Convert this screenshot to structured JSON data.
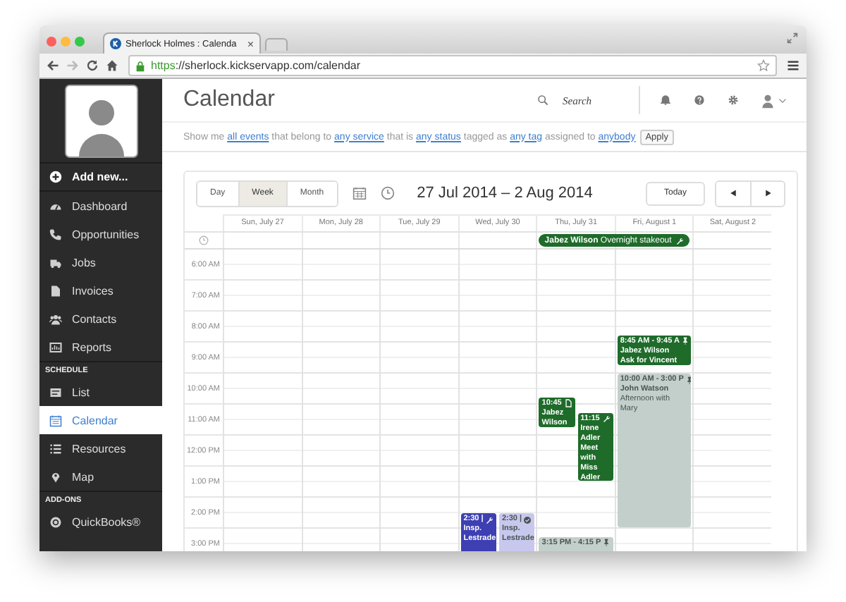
{
  "browser": {
    "tab_title": "Sherlock Holmes : Calenda",
    "tab_close": "×",
    "url_scheme": "https",
    "url_rest": "://sherlock.kickservapp.com/calendar"
  },
  "sidebar": {
    "add_new": "Add new...",
    "groups": [
      {
        "items": [
          {
            "label": "Dashboard",
            "selected": false
          },
          {
            "label": "Opportunities",
            "selected": false
          },
          {
            "label": "Jobs",
            "selected": false
          },
          {
            "label": "Invoices",
            "selected": false
          },
          {
            "label": "Contacts",
            "selected": false
          },
          {
            "label": "Reports",
            "selected": false
          }
        ]
      },
      {
        "heading": "SCHEDULE",
        "items": [
          {
            "label": "List",
            "selected": false
          },
          {
            "label": "Calendar",
            "selected": true
          },
          {
            "label": "Resources",
            "selected": false
          },
          {
            "label": "Map",
            "selected": false
          }
        ]
      },
      {
        "heading": "ADD-ONS",
        "items": [
          {
            "label": "QuickBooks®",
            "selected": false
          }
        ]
      }
    ]
  },
  "header": {
    "title": "Calendar",
    "search": {
      "placeholder": "Search"
    }
  },
  "filter": {
    "parts": [
      {
        "text": "Show me ",
        "link": false
      },
      {
        "text": "all events",
        "link": true
      },
      {
        "text": " that belong to ",
        "link": false
      },
      {
        "text": "any service",
        "link": true
      },
      {
        "text": " that is ",
        "link": false
      },
      {
        "text": "any status",
        "link": true
      },
      {
        "text": " tagged as ",
        "link": false
      },
      {
        "text": "any tag",
        "link": true
      },
      {
        "text": " assigned to ",
        "link": false
      },
      {
        "text": "anybody",
        "link": true
      }
    ],
    "button": "Apply"
  },
  "calendar": {
    "views": [
      {
        "label": "Day",
        "selected": false
      },
      {
        "label": "Week",
        "selected": true
      },
      {
        "label": "Month",
        "selected": false
      }
    ],
    "range": "27 Jul 2014 – 2 Aug 2014",
    "today_button": "Today",
    "all_day": [
      {
        "client": "Jabez Wilson",
        "title": "Overnight stakeout",
        "kind": "job",
        "color": "#1e6b2a"
      }
    ],
    "days": [
      {
        "label": "Sun, July 27"
      },
      {
        "label": "Mon, July 28"
      },
      {
        "label": "Tue, July 29"
      },
      {
        "label": "Wed, July 30",
        "events": [
          {
            "time": "2:30 |",
            "client": "Insp. Lestrade",
            "kind": "job",
            "color": "#3d3fb3"
          },
          {
            "time": "2:30 |",
            "client": "Insp. Lestrade",
            "kind": "done",
            "color": "#c8c8ee"
          }
        ]
      },
      {
        "label": "Thu, July 31",
        "events": [
          {
            "time": "10:45",
            "client": "Jabez Wilson",
            "kind": "note",
            "color": "#1e6b2a"
          },
          {
            "time": "11:15",
            "client": "Irene Adler",
            "title": "Meet with Miss Adler",
            "kind": "job",
            "color": "#1e6b2a"
          },
          {
            "time": "3:15 PM - 4:15 P",
            "kind": "appointment",
            "color": "#c3cfcb"
          }
        ]
      },
      {
        "label": "Fri, August 1",
        "events": [
          {
            "time": "8:45 AM - 9:45 A",
            "client": "Jabez Wilson",
            "title": "Ask for Vincent",
            "kind": "appointment",
            "color": "#1e6b2a"
          },
          {
            "time": "10:00 AM - 3:00 P",
            "client": "John Watson",
            "title": "Afternoon with Mary",
            "kind": "appointment",
            "color": "#c3cfcb"
          }
        ]
      },
      {
        "label": "Sat, August 2"
      }
    ],
    "hours": [
      "6:00 AM",
      "7:00 AM",
      "8:00 AM",
      "9:00 AM",
      "10:00 AM",
      "11:00 AM",
      "12:00 PM",
      "1:00 PM",
      "2:00 PM",
      "3:00 PM"
    ]
  }
}
